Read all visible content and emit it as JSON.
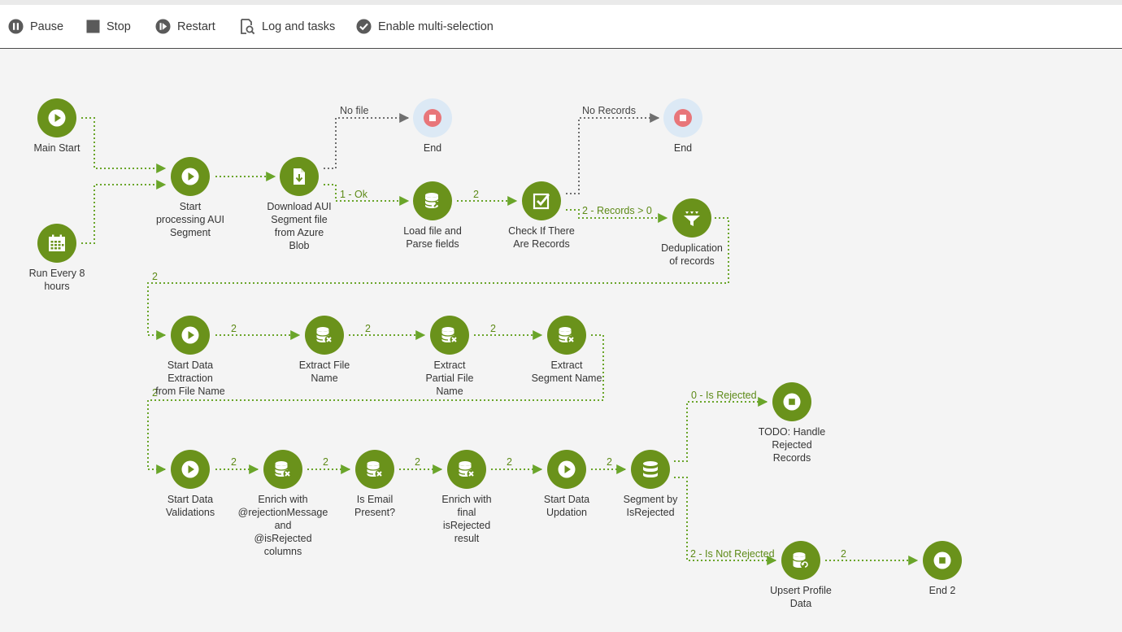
{
  "toolbar": {
    "pause": "Pause",
    "stop": "Stop",
    "restart": "Restart",
    "log": "Log and tasks",
    "multi": "Enable multi-selection"
  },
  "colors": {
    "node": "#6a921b",
    "end_node": "#dce9f5",
    "end_stop": "#e8767a",
    "link": "#6aa52a",
    "link_gray": "#6f6f6f"
  },
  "nodes": {
    "main_start": {
      "label": "Main Start",
      "icon": "play-icon"
    },
    "run_every": {
      "label": "Run Every 8\nhours",
      "icon": "calendar-icon"
    },
    "start_processing": {
      "label": "Start\nprocessing AUI\nSegment",
      "icon": "play-icon"
    },
    "download": {
      "label": "Download AUI\nSegment file\nfrom Azure\nBlob",
      "icon": "file-download-icon"
    },
    "end1": {
      "label": "End",
      "icon": "stop-icon"
    },
    "load_file": {
      "label": "Load file and\nParse fields",
      "icon": "database-load-icon"
    },
    "check_records": {
      "label": "Check If There\nAre Records",
      "icon": "checkbox-icon"
    },
    "end2": {
      "label": "End",
      "icon": "stop-icon"
    },
    "dedup": {
      "label": "Deduplication\nof records",
      "icon": "funnel-icon"
    },
    "start_extraction": {
      "label": "Start Data\nExtraction\nfrom File Name",
      "icon": "play-icon"
    },
    "extract_file": {
      "label": "Extract File\nName",
      "icon": "database-enrich-icon"
    },
    "extract_partial": {
      "label": "Extract\nPartial File\nName",
      "icon": "database-enrich-icon"
    },
    "extract_segment": {
      "label": "Extract\nSegment Name",
      "icon": "database-enrich-icon"
    },
    "start_validations": {
      "label": "Start Data\nValidations",
      "icon": "play-icon"
    },
    "enrich_rejection": {
      "label": "Enrich with\n@rejectionMessage\nand\n@isRejected\ncolumns",
      "icon": "database-enrich-icon"
    },
    "is_email": {
      "label": "Is Email\nPresent?",
      "icon": "database-enrich-icon"
    },
    "enrich_final": {
      "label": "Enrich with\nfinal\nisRejected\nresult",
      "icon": "database-enrich-icon"
    },
    "start_updation": {
      "label": "Start Data\nUpdation",
      "icon": "play-icon"
    },
    "segment_rejected": {
      "label": "Segment by\nIsRejected",
      "icon": "database-split-icon"
    },
    "todo": {
      "label": "TODO: Handle\nRejected\nRecords",
      "icon": "stop-icon"
    },
    "upsert": {
      "label": "Upsert Profile\nData",
      "icon": "database-refresh-icon"
    },
    "end_2": {
      "label": "End 2",
      "icon": "stop-icon"
    }
  },
  "edges": {
    "no_file": "No file",
    "ok": "1 - Ok",
    "load_check": "2",
    "no_records": "No Records",
    "records_gt0": "2 - Records > 0",
    "dedup_out": "2",
    "ex1": "2",
    "ex2": "2",
    "ex3": "2",
    "ex_out": "2",
    "v1": "2",
    "v2": "2",
    "v3": "2",
    "v4": "2",
    "v5": "2",
    "is_rejected": "0 - Is Rejected",
    "is_not_rejected": "2 - Is Not Rejected",
    "upsert_end": "2"
  }
}
